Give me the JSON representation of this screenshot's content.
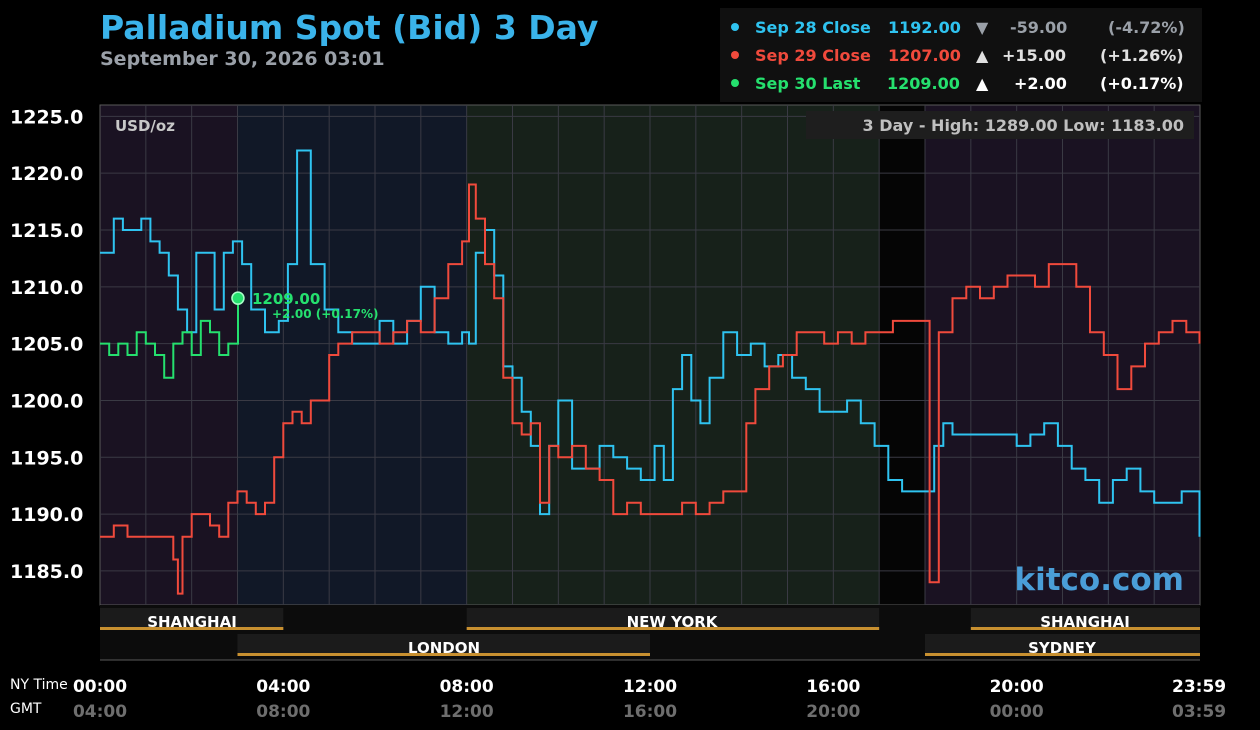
{
  "header": {
    "title": "Palladium Spot (Bid) 3 Day",
    "subtitle": "September 30, 2026 03:01"
  },
  "legend": [
    {
      "label": "Sep 28 Close",
      "price": "1192.00",
      "arrow": "▼",
      "change": "-59.00",
      "pct": "(-4.72%)",
      "color": "#2fc3f0",
      "text_color": "#2fc3f0",
      "change_color": "#9aa0a8"
    },
    {
      "label": "Sep 29 Close",
      "price": "1207.00",
      "arrow": "▲",
      "change": "+15.00",
      "pct": "(+1.26%)",
      "color": "#f04a3c",
      "text_color": "#f04a3c",
      "change_color": "#e0e0e0"
    },
    {
      "label": "Sep 30 Last",
      "price": "1209.00",
      "arrow": "▲",
      "change": "+2.00",
      "pct": "(+0.17%)",
      "color": "#25e06e",
      "text_color": "#25e06e",
      "change_color": "#ffffff"
    }
  ],
  "plot": {
    "unit_label": "USD/oz",
    "range_text": "3 Day - High: 1289.00  Low: 1183.00",
    "watermark": "kitco.com",
    "last_marker": {
      "price": "1209.00",
      "change": "+2.00 (+0.17%)"
    }
  },
  "sessions": {
    "shanghai_1": "SHANGHAI",
    "new_york": "NEW YORK",
    "shanghai_2": "SHANGHAI",
    "london": "LONDON",
    "sydney": "SYDNEY"
  },
  "time_axis": {
    "ny_label": "NY Time",
    "gmt_label": "GMT",
    "ny_ticks": [
      "00:00",
      "04:00",
      "08:00",
      "12:00",
      "16:00",
      "20:00",
      "23:59"
    ],
    "gmt_ticks": [
      "04:00",
      "08:00",
      "12:00",
      "16:00",
      "20:00",
      "00:00",
      "03:59"
    ]
  },
  "chart_data": {
    "type": "line",
    "title": "Palladium Spot (Bid) 3 Day",
    "ylabel": "USD/oz",
    "ylim": [
      1182,
      1226
    ],
    "xlim": [
      0,
      24
    ],
    "y_ticks": [
      1185.0,
      1190.0,
      1195.0,
      1200.0,
      1205.0,
      1210.0,
      1215.0,
      1220.0,
      1225.0
    ],
    "grid": true,
    "series": [
      {
        "name": "Sep 28 Close",
        "color": "#2fc3f0",
        "x": [
          0,
          0.3,
          0.5,
          0.7,
          0.9,
          1.1,
          1.3,
          1.5,
          1.7,
          1.9,
          2.1,
          2.3,
          2.5,
          2.7,
          2.9,
          3.1,
          3.3,
          3.6,
          3.9,
          4.1,
          4.3,
          4.6,
          4.9,
          5.2,
          5.5,
          5.8,
          6.1,
          6.4,
          6.7,
          7.0,
          7.3,
          7.6,
          7.9,
          8.05,
          8.2,
          8.4,
          8.6,
          8.8,
          9.0,
          9.2,
          9.4,
          9.6,
          9.8,
          10.0,
          10.3,
          10.6,
          10.9,
          11.2,
          11.5,
          11.8,
          12.1,
          12.3,
          12.5,
          12.7,
          12.9,
          13.1,
          13.3,
          13.6,
          13.9,
          14.2,
          14.5,
          14.8,
          15.1,
          15.4,
          15.7,
          16.0,
          16.3,
          16.6,
          16.9,
          17.2,
          17.5,
          17.8,
          18.0,
          18.2,
          18.4,
          18.6,
          18.8,
          19.1,
          19.4,
          19.7,
          20.0,
          20.3,
          20.6,
          20.9,
          21.2,
          21.5,
          21.8,
          22.1,
          22.4,
          22.7,
          23.0,
          23.3,
          23.6,
          23.99
        ],
        "y": [
          1213,
          1216,
          1215,
          1215,
          1216,
          1214,
          1213,
          1211,
          1208,
          1206,
          1213,
          1213,
          1208,
          1213,
          1214,
          1212,
          1208,
          1206,
          1207,
          1212,
          1222,
          1212,
          1208,
          1206,
          1205,
          1205,
          1207,
          1205,
          1207,
          1210,
          1206,
          1205,
          1206,
          1205,
          1213,
          1215,
          1211,
          1203,
          1202,
          1199,
          1196,
          1190,
          1196,
          1200,
          1194,
          1194,
          1196,
          1195,
          1194,
          1193,
          1196,
          1193,
          1201,
          1204,
          1200,
          1198,
          1202,
          1206,
          1204,
          1205,
          1203,
          1204,
          1202,
          1201,
          1199,
          1199,
          1200,
          1198,
          1196,
          1193,
          1192,
          1192,
          1192,
          1196,
          1198,
          1197,
          1197,
          1197,
          1197,
          1197,
          1196,
          1197,
          1198,
          1196,
          1194,
          1193,
          1191,
          1193,
          1194,
          1192,
          1191,
          1191,
          1192,
          1188
        ]
      },
      {
        "name": "Sep 29 Close",
        "color": "#f04a3c",
        "x": [
          0,
          0.3,
          0.6,
          0.9,
          1.2,
          1.5,
          1.6,
          1.7,
          1.8,
          2.0,
          2.2,
          2.4,
          2.6,
          2.8,
          3.0,
          3.2,
          3.4,
          3.6,
          3.8,
          4.0,
          4.2,
          4.4,
          4.6,
          4.8,
          5.0,
          5.2,
          5.5,
          5.8,
          6.1,
          6.4,
          6.7,
          7.0,
          7.3,
          7.6,
          7.9,
          8.05,
          8.2,
          8.4,
          8.6,
          8.8,
          9.0,
          9.2,
          9.4,
          9.6,
          9.8,
          10.0,
          10.3,
          10.6,
          10.9,
          11.2,
          11.5,
          11.8,
          12.1,
          12.4,
          12.7,
          13.0,
          13.3,
          13.6,
          13.9,
          14.1,
          14.3,
          14.6,
          14.9,
          15.2,
          15.5,
          15.8,
          16.1,
          16.4,
          16.7,
          17.0,
          17.3,
          17.6,
          17.9,
          18.0,
          18.1,
          18.3,
          18.6,
          18.9,
          19.2,
          19.5,
          19.8,
          20.1,
          20.4,
          20.7,
          21.0,
          21.3,
          21.6,
          21.9,
          22.2,
          22.5,
          22.8,
          23.1,
          23.4,
          23.7,
          23.99
        ],
        "y": [
          1188,
          1189,
          1188,
          1188,
          1188,
          1188,
          1186,
          1183,
          1188,
          1190,
          1190,
          1189,
          1188,
          1191,
          1192,
          1191,
          1190,
          1191,
          1195,
          1198,
          1199,
          1198,
          1200,
          1200,
          1204,
          1205,
          1206,
          1206,
          1205,
          1206,
          1207,
          1206,
          1209,
          1212,
          1214,
          1219,
          1216,
          1212,
          1209,
          1202,
          1198,
          1197,
          1198,
          1191,
          1196,
          1195,
          1196,
          1194,
          1193,
          1190,
          1191,
          1190,
          1190,
          1190,
          1191,
          1190,
          1191,
          1192,
          1192,
          1198,
          1201,
          1203,
          1204,
          1206,
          1206,
          1205,
          1206,
          1205,
          1206,
          1206,
          1207,
          1207,
          1207,
          1207,
          1184,
          1206,
          1209,
          1210,
          1209,
          1210,
          1211,
          1211,
          1210,
          1212,
          1212,
          1210,
          1206,
          1204,
          1201,
          1203,
          1205,
          1206,
          1207,
          1206,
          1205
        ]
      },
      {
        "name": "Sep 30 Last",
        "color": "#25e06e",
        "x": [
          0,
          0.2,
          0.4,
          0.6,
          0.8,
          1.0,
          1.2,
          1.4,
          1.6,
          1.8,
          2.0,
          2.2,
          2.4,
          2.6,
          2.8,
          3.01
        ],
        "y": [
          1205,
          1204,
          1205,
          1204,
          1206,
          1205,
          1204,
          1202,
          1205,
          1206,
          1204,
          1207,
          1206,
          1204,
          1205,
          1209
        ]
      }
    ]
  }
}
